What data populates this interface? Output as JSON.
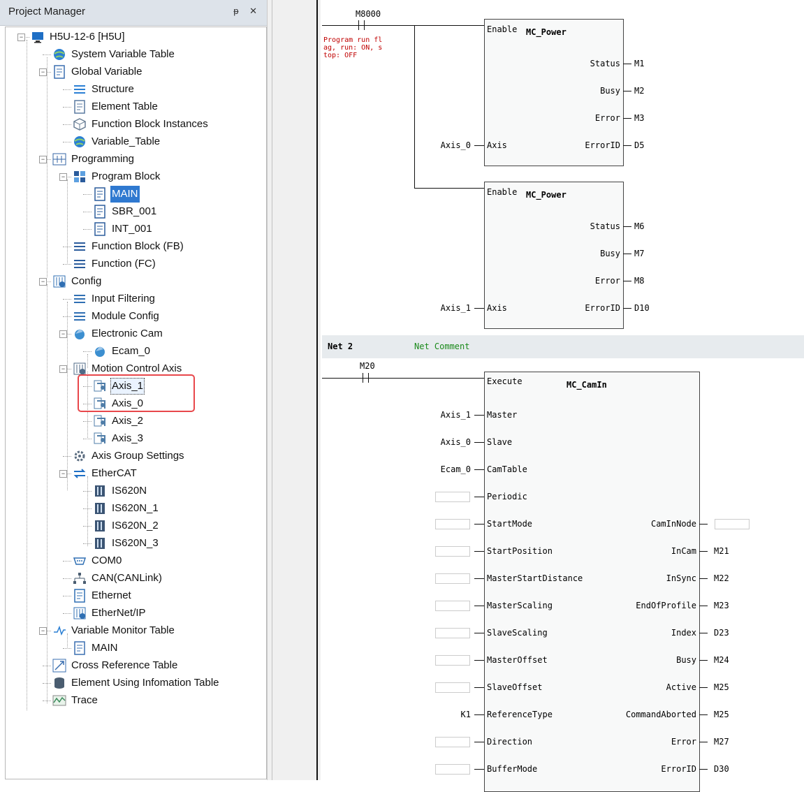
{
  "panel": {
    "title": "Project Manager",
    "pin_icon": "pin-icon",
    "close_icon": "close-icon",
    "pin_glyph": "ᵽ",
    "close_glyph": "✕"
  },
  "tree": [
    {
      "label": "H5U-12-6 [H5U]",
      "icon": "plc-icon",
      "level": 0
    },
    {
      "label": "System Variable Table",
      "icon": "globe-icon",
      "level": 1
    },
    {
      "label": "Global Variable",
      "icon": "table-icon",
      "level": 1
    },
    {
      "label": "Structure",
      "icon": "structure-icon",
      "level": 2
    },
    {
      "label": "Element Table",
      "icon": "doc-icon",
      "level": 2
    },
    {
      "label": "Function Block Instances",
      "icon": "cube-icon",
      "level": 2
    },
    {
      "label": "Variable_Table",
      "icon": "globe-icon",
      "level": 2
    },
    {
      "label": "Programming",
      "icon": "ladder-icon",
      "level": 1
    },
    {
      "label": "Program Block",
      "icon": "blocks-icon",
      "level": 2
    },
    {
      "label": "MAIN",
      "icon": "main-program-icon",
      "level": 3,
      "selected": true
    },
    {
      "label": "SBR_001",
      "icon": "subroutine-icon",
      "level": 3
    },
    {
      "label": "INT_001",
      "icon": "interrupt-icon",
      "level": 3
    },
    {
      "label": "Function Block (FB)",
      "icon": "fb-icon",
      "level": 2
    },
    {
      "label": "Function (FC)",
      "icon": "fc-icon",
      "level": 2
    },
    {
      "label": "Config",
      "icon": "config-icon",
      "level": 1
    },
    {
      "label": "Input Filtering",
      "icon": "filter-icon",
      "level": 2
    },
    {
      "label": "Module Config",
      "icon": "module-icon",
      "level": 2
    },
    {
      "label": "Electronic Cam",
      "icon": "cam-icon",
      "level": 2
    },
    {
      "label": "Ecam_0",
      "icon": "cam-icon",
      "level": 3
    },
    {
      "label": "Motion Control Axis",
      "icon": "axis-group-icon",
      "level": 2
    },
    {
      "label": "Axis_1",
      "icon": "axis-icon",
      "level": 3,
      "focused": true
    },
    {
      "label": "Axis_0",
      "icon": "axis-icon",
      "level": 3
    },
    {
      "label": "Axis_2",
      "icon": "axis-icon",
      "level": 3
    },
    {
      "label": "Axis_3",
      "icon": "axis-icon",
      "level": 3
    },
    {
      "label": "Axis Group Settings",
      "icon": "gear-icon",
      "level": 2
    },
    {
      "label": "EtherCAT",
      "icon": "ethercat-icon",
      "level": 2
    },
    {
      "label": "IS620N",
      "icon": "servo-icon",
      "level": 3
    },
    {
      "label": "IS620N_1",
      "icon": "servo-icon",
      "level": 3
    },
    {
      "label": "IS620N_2",
      "icon": "servo-icon",
      "level": 3
    },
    {
      "label": "IS620N_3",
      "icon": "servo-icon",
      "level": 3
    },
    {
      "label": "COM0",
      "icon": "serial-port-icon",
      "level": 2
    },
    {
      "label": "CAN(CANLink)",
      "icon": "network-icon",
      "level": 2
    },
    {
      "label": "Ethernet",
      "icon": "ethernet-icon",
      "level": 2
    },
    {
      "label": "EtherNet/IP",
      "icon": "config-icon",
      "level": 2
    },
    {
      "label": "Variable Monitor Table",
      "icon": "monitor-icon",
      "level": 1
    },
    {
      "label": "MAIN",
      "icon": "table-icon",
      "level": 2
    },
    {
      "label": "Cross Reference Table",
      "icon": "cross-ref-icon",
      "level": 1
    },
    {
      "label": "Element Using Infomation Table",
      "icon": "database-icon",
      "level": 1
    },
    {
      "label": "Trace",
      "icon": "trace-icon",
      "level": 1
    }
  ],
  "ladder": {
    "net1": {
      "contact": "M8000",
      "comment": [
        "Program run fl",
        "ag, run: ON, s",
        "top: OFF"
      ],
      "blocks": [
        {
          "name": "MC_Power",
          "enable": "Enable",
          "inputs": [
            {
              "pin": "Axis",
              "var": "Axis_0"
            }
          ],
          "outputs": [
            {
              "pin": "Status",
              "var": "M1"
            },
            {
              "pin": "Busy",
              "var": "M2"
            },
            {
              "pin": "Error",
              "var": "M3"
            },
            {
              "pin": "ErrorID",
              "var": "D5"
            }
          ]
        },
        {
          "name": "MC_Power",
          "enable": "Enable",
          "inputs": [
            {
              "pin": "Axis",
              "var": "Axis_1"
            }
          ],
          "outputs": [
            {
              "pin": "Status",
              "var": "M6"
            },
            {
              "pin": "Busy",
              "var": "M7"
            },
            {
              "pin": "Error",
              "var": "M8"
            },
            {
              "pin": "ErrorID",
              "var": "D10"
            }
          ]
        }
      ]
    },
    "net2": {
      "label": "Net 2",
      "comment": "Net Comment",
      "contact": "M20",
      "block": {
        "name": "MC_CamIn",
        "execute": "Execute",
        "inputs": [
          {
            "pin": "Master",
            "var": "Axis_1"
          },
          {
            "pin": "Slave",
            "var": "Axis_0"
          },
          {
            "pin": "CamTable",
            "var": "Ecam_0"
          },
          {
            "pin": "Periodic",
            "var": ""
          },
          {
            "pin": "StartMode",
            "var": ""
          },
          {
            "pin": "StartPosition",
            "var": ""
          },
          {
            "pin": "MasterStartDistance",
            "var": ""
          },
          {
            "pin": "MasterScaling",
            "var": ""
          },
          {
            "pin": "SlaveScaling",
            "var": ""
          },
          {
            "pin": "MasterOffset",
            "var": ""
          },
          {
            "pin": "SlaveOffset",
            "var": ""
          },
          {
            "pin": "ReferenceType",
            "var": "K1"
          },
          {
            "pin": "Direction",
            "var": ""
          },
          {
            "pin": "BufferMode",
            "var": ""
          }
        ],
        "outputs": [
          {
            "pin": "CamInNode",
            "var": "",
            "row": 4
          },
          {
            "pin": "InCam",
            "var": "M21",
            "row": 5
          },
          {
            "pin": "InSync",
            "var": "M22",
            "row": 6
          },
          {
            "pin": "EndOfProfile",
            "var": "M23",
            "row": 7
          },
          {
            "pin": "Index",
            "var": "D23",
            "row": 8
          },
          {
            "pin": "Busy",
            "var": "M24",
            "row": 9
          },
          {
            "pin": "Active",
            "var": "M25",
            "row": 10
          },
          {
            "pin": "CommandAborted",
            "var": "M25",
            "row": 11
          },
          {
            "pin": "Error",
            "var": "M27",
            "row": 12
          },
          {
            "pin": "ErrorID",
            "var": "D30",
            "row": 13
          }
        ]
      }
    }
  },
  "colors": {
    "selection": "#2f79d0",
    "highlight": "#e8474b",
    "comment": "#c00000",
    "net_comment": "#1a8a1a"
  }
}
